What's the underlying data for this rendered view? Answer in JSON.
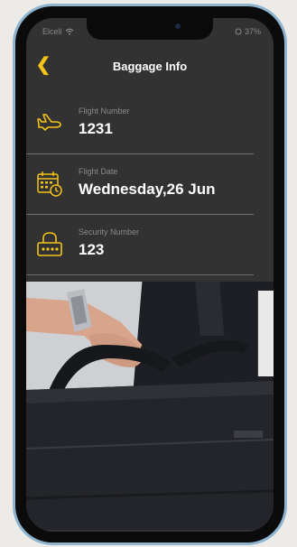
{
  "status": {
    "carrier": "Elcell",
    "battery": "37%"
  },
  "nav": {
    "title": "Baggage Info",
    "back_glyph": "❮"
  },
  "rows": [
    {
      "label": "Flight Number",
      "value": "1231",
      "icon": "airplane-icon"
    },
    {
      "label": "Flight Date",
      "value": "Wednesday,26 Jun",
      "icon": "calendar-clock-icon"
    },
    {
      "label": "Security Number",
      "value": "123",
      "icon": "padlock-icon"
    }
  ],
  "accent_color": "#f2c318",
  "background_color": "#323232"
}
